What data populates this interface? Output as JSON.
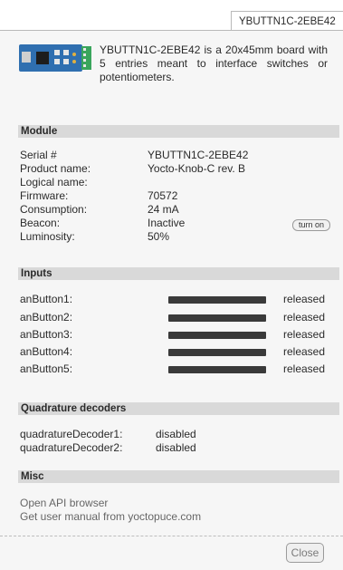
{
  "tab": {
    "label": "YBUTTN1C-2EBE42"
  },
  "description": "YBUTTN1C-2EBE42 is a 20x45mm board with 5 entries meant to interface switches or potentiometers.",
  "module": {
    "heading": "Module",
    "fields": [
      {
        "label": "Serial #",
        "value": "YBUTTN1C-2EBE42"
      },
      {
        "label": "Product name:",
        "value": "Yocto-Knob-C rev. B"
      },
      {
        "label": "Logical name:",
        "value": ""
      },
      {
        "label": "Firmware:",
        "value": "70572"
      },
      {
        "label": "Consumption:",
        "value": "24 mA"
      },
      {
        "label": "Beacon:",
        "value": "Inactive"
      },
      {
        "label": "Luminosity:",
        "value": "50%"
      }
    ],
    "beacon_button": "turn on"
  },
  "inputs": {
    "heading": "Inputs",
    "items": [
      {
        "label": "anButton1:",
        "level": 1.0,
        "state": "released"
      },
      {
        "label": "anButton2:",
        "level": 1.0,
        "state": "released"
      },
      {
        "label": "anButton3:",
        "level": 1.0,
        "state": "released"
      },
      {
        "label": "anButton4:",
        "level": 1.0,
        "state": "released"
      },
      {
        "label": "anButton5:",
        "level": 1.0,
        "state": "released"
      }
    ]
  },
  "quadrature": {
    "heading": "Quadrature decoders",
    "items": [
      {
        "label": "quadratureDecoder1:",
        "value": "disabled"
      },
      {
        "label": "quadratureDecoder2:",
        "value": "disabled"
      }
    ]
  },
  "misc": {
    "heading": "Misc",
    "links": [
      "Open API browser",
      "Get user manual from yoctopuce.com"
    ]
  },
  "footer": {
    "close_label": "Close"
  },
  "colors": {
    "section_bg": "#d9d9d9",
    "panel_bg": "#f6f6f6",
    "bar": "#3a3a3a"
  }
}
